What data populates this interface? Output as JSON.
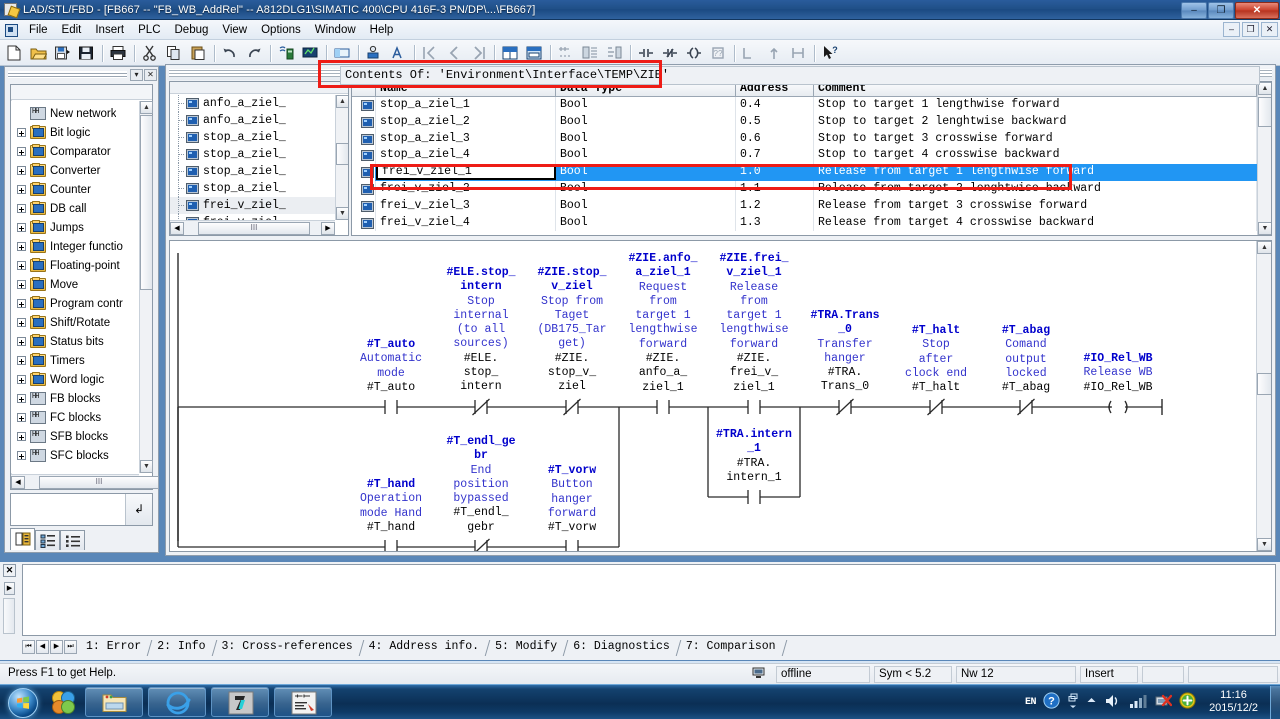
{
  "window": {
    "title": "LAD/STL/FBD  - [FB667 -- \"FB_WB_AddRel\" -- A812DLG1\\SIMATIC 400\\CPU 416F-3 PN/DP\\...\\FB667]",
    "minimize_label": "–",
    "restore_label": "❐",
    "close_label": "✕",
    "mdi_minimize_label": "–",
    "mdi_restore_label": "❐",
    "mdi_close_label": "✕"
  },
  "menu": {
    "items": [
      {
        "label": "File"
      },
      {
        "label": "Edit"
      },
      {
        "label": "Insert"
      },
      {
        "label": "PLC"
      },
      {
        "label": "Debug"
      },
      {
        "label": "View"
      },
      {
        "label": "Options"
      },
      {
        "label": "Window"
      },
      {
        "label": "Help"
      }
    ]
  },
  "toolbar": {
    "buttons": [
      {
        "name": "new-icon"
      },
      {
        "name": "open-icon"
      },
      {
        "name": "save-as-icon"
      },
      {
        "name": "save-icon"
      },
      {
        "sep": true
      },
      {
        "name": "print-icon"
      },
      {
        "sep": true
      },
      {
        "name": "cut-icon"
      },
      {
        "name": "copy-icon"
      },
      {
        "name": "paste-icon"
      },
      {
        "sep": true
      },
      {
        "name": "undo-icon"
      },
      {
        "name": "redo-icon"
      },
      {
        "sep": true
      },
      {
        "name": "download-icon"
      },
      {
        "name": "monitor-icon"
      },
      {
        "sep": true
      },
      {
        "name": "overview-icon"
      },
      {
        "sep": true
      },
      {
        "name": "symbol-icon"
      },
      {
        "name": "symbol-info-icon"
      },
      {
        "sep": true
      },
      {
        "name": "goto-first-icon"
      },
      {
        "name": "goto-prev-icon"
      },
      {
        "name": "goto-next-icon"
      },
      {
        "sep": true
      },
      {
        "name": "declaration-view-icon"
      },
      {
        "name": "code-view-icon"
      },
      {
        "sep": true
      },
      {
        "name": "new-network-icon"
      },
      {
        "name": "program-elements-icon"
      },
      {
        "name": "call-structure-icon"
      },
      {
        "sep": true
      },
      {
        "name": "contact-no-icon"
      },
      {
        "name": "contact-nc-icon"
      },
      {
        "name": "coil-icon"
      },
      {
        "name": "empty-box-icon"
      },
      {
        "sep": true
      },
      {
        "name": "branch-open-icon"
      },
      {
        "name": "branch-up-icon"
      },
      {
        "name": "branch-close-icon"
      },
      {
        "sep": true
      },
      {
        "name": "help-context-icon"
      }
    ]
  },
  "program_elements": {
    "panel_title": "",
    "dropdown_label": "▾",
    "close_label": "✕",
    "items": [
      {
        "label": "New network",
        "icon": "new-network-icon",
        "expandable": false
      },
      {
        "label": "Bit logic",
        "icon": "folder-icon",
        "expandable": true
      },
      {
        "label": "Comparator",
        "icon": "folder-icon",
        "expandable": true
      },
      {
        "label": "Converter",
        "icon": "folder-icon",
        "expandable": true
      },
      {
        "label": "Counter",
        "icon": "folder-icon",
        "expandable": true
      },
      {
        "label": "DB call",
        "icon": "folder-icon",
        "expandable": true
      },
      {
        "label": "Jumps",
        "icon": "folder-icon",
        "expandable": true
      },
      {
        "label": "Integer functio",
        "icon": "folder-icon",
        "expandable": true
      },
      {
        "label": "Floating-point",
        "icon": "folder-icon",
        "expandable": true
      },
      {
        "label": "Move",
        "icon": "folder-icon",
        "expandable": true
      },
      {
        "label": "Program contr",
        "icon": "folder-icon",
        "expandable": true
      },
      {
        "label": "Shift/Rotate",
        "icon": "folder-icon",
        "expandable": true
      },
      {
        "label": "Status bits",
        "icon": "folder-icon",
        "expandable": true
      },
      {
        "label": "Timers",
        "icon": "folder-icon",
        "expandable": true
      },
      {
        "label": "Word logic",
        "icon": "folder-icon",
        "expandable": true
      },
      {
        "label": "FB blocks",
        "icon": "fb-icon",
        "expandable": true
      },
      {
        "label": "FC blocks",
        "icon": "fc-icon",
        "expandable": true
      },
      {
        "label": "SFB blocks",
        "icon": "sfb-icon",
        "expandable": true
      },
      {
        "label": "SFC blocks",
        "icon": "sfc-icon",
        "expandable": true
      }
    ],
    "scroll_up": "▲",
    "scroll_down": "▼",
    "h_left": "◀",
    "h_right": "▶",
    "h_thumb_label": "III",
    "jump_button": "↲",
    "tabs": [
      {
        "name": "tab-program-elements",
        "active": true
      },
      {
        "name": "tab-call-structure",
        "active": false
      },
      {
        "name": "tab-details",
        "active": false
      }
    ]
  },
  "declaration": {
    "contents_of": "Contents Of: 'Environment\\Interface\\TEMP\\ZIE'",
    "nav_items": [
      {
        "label": "anfo_a_ziel_",
        "selected": false
      },
      {
        "label": "anfo_a_ziel_",
        "selected": false
      },
      {
        "label": "stop_a_ziel_",
        "selected": false
      },
      {
        "label": "stop_a_ziel_",
        "selected": false
      },
      {
        "label": "stop_a_ziel_",
        "selected": false
      },
      {
        "label": "stop_a_ziel_",
        "selected": false
      },
      {
        "label": "frei_v_ziel_",
        "selected": true
      },
      {
        "label": "frei_v_ziel_",
        "selected": false
      }
    ],
    "columns": [
      "Name",
      "Data Type",
      "Address",
      "Comment"
    ],
    "rows": [
      {
        "name": "stop_a_ziel_1",
        "type": "Bool",
        "address": "0.4",
        "comment": "Stop to target 1 lengthwise forward",
        "selected": false,
        "editing": false
      },
      {
        "name": "stop_a_ziel_2",
        "type": "Bool",
        "address": "0.5",
        "comment": "Stop to target 2 lenghtwise backward",
        "selected": false,
        "editing": false
      },
      {
        "name": "stop_a_ziel_3",
        "type": "Bool",
        "address": "0.6",
        "comment": "Stop to target 3 crosswise forward",
        "selected": false,
        "editing": false
      },
      {
        "name": "stop_a_ziel_4",
        "type": "Bool",
        "address": "0.7",
        "comment": "Stop to target 4 crosswise backward",
        "selected": false,
        "editing": false
      },
      {
        "name": "frei_v_ziel_1",
        "type": "Bool",
        "address": "1.0",
        "comment": "Release from target 1 lengthwise forward",
        "selected": true,
        "editing": true
      },
      {
        "name": "frei_v_ziel_2",
        "type": "Bool",
        "address": "1.1",
        "comment": "Release from target 2 lenghtwise backward",
        "selected": false,
        "editing": false
      },
      {
        "name": "frei_v_ziel_3",
        "type": "Bool",
        "address": "1.2",
        "comment": "Release from target 3 crosswise forward",
        "selected": false,
        "editing": false
      },
      {
        "name": "frei_v_ziel_4",
        "type": "Bool",
        "address": "1.3",
        "comment": "Release from target 4 crosswise backward",
        "selected": false,
        "editing": false
      }
    ]
  },
  "ladder": {
    "rung1": [
      {
        "symbol": "#T_auto",
        "comment": "Automatic\nmode",
        "address": "#T_auto",
        "type": "contact-no"
      },
      {
        "symbol": "#ELE.stop_\nintern",
        "comment": "Stop\ninternal\n(to all\nsources)",
        "address": "#ELE.\nstop_\nintern",
        "type": "contact-nc"
      },
      {
        "symbol": "#ZIE.stop_\nv_ziel",
        "comment": "Stop from\nTaget\n(DB175_Tar\nget)",
        "address": "#ZIE.\nstop_v_\nziel",
        "type": "contact-nc"
      },
      {
        "symbol": "#ZIE.anfo_\na_ziel_1",
        "comment": "Request\nfrom\ntarget 1\nlengthwise\nforward",
        "address": "#ZIE.\nanfo_a_\nziel_1",
        "type": "contact-no"
      },
      {
        "symbol": "#ZIE.frei_\nv_ziel_1",
        "comment": "Release\nfrom\ntarget 1\nlengthwise\nforward",
        "address": "#ZIE.\nfrei_v_\nziel_1",
        "type": "contact-no"
      },
      {
        "symbol": "#TRA.Trans\n_0",
        "comment": "Transfer\nhanger",
        "address": "#TRA.\nTrans_0",
        "type": "contact-nc"
      },
      {
        "symbol": "#T_halt",
        "comment": "Stop\nafter\nclock end",
        "address": "#T_halt",
        "type": "contact-nc"
      },
      {
        "symbol": "#T_abag",
        "comment": "Comand\noutput\nlocked",
        "address": "#T_abag",
        "type": "contact-nc"
      },
      {
        "symbol": "#IO_Rel_WB",
        "comment": "Release WB",
        "address": "#IO_Rel_WB",
        "type": "coil"
      }
    ],
    "rung2": [
      {
        "symbol": "#T_hand",
        "comment": "Operation\nmode Hand",
        "address": "#T_hand",
        "type": "contact-no"
      },
      {
        "symbol": "#T_endl_ge\nbr",
        "comment": "End\nposition\nbypassed",
        "address": "#T_endl_\ngebr",
        "type": "contact-nc"
      },
      {
        "symbol": "#T_vorw",
        "comment": "Button\nhanger\nforward",
        "address": "#T_vorw",
        "type": "contact-no"
      },
      {
        "symbol": "#TRA.intern\n_1",
        "comment": "",
        "address": "#TRA.\nintern_1",
        "type": "contact-no"
      }
    ],
    "scroll_up": "▲",
    "scroll_down": "▼"
  },
  "output": {
    "close_label": "✕",
    "expand_label": "▶",
    "nav": [
      "⏮",
      "◀",
      "▶",
      "⏭"
    ],
    "tabs": [
      {
        "label": "1: Error",
        "active": false
      },
      {
        "label": "2: Info",
        "active": true
      },
      {
        "label": "3: Cross-references",
        "active": false
      },
      {
        "label": "4: Address info.",
        "active": false
      },
      {
        "label": "5: Modify",
        "active": false
      },
      {
        "label": "6: Diagnostics",
        "active": false
      },
      {
        "label": "7: Comparison",
        "active": false
      }
    ]
  },
  "statusbar": {
    "message": "Press F1 to get Help.",
    "connection": "offline",
    "symbols": "Sym < 5.2",
    "network": "Nw 12",
    "mode": "Insert"
  },
  "taskbar": {
    "start_label": "Start",
    "quick_items": [
      {
        "name": "explorer-icon"
      },
      {
        "name": "internet-explorer-icon"
      },
      {
        "name": "step7-icon"
      },
      {
        "name": "lad-stl-fbd-icon"
      }
    ],
    "tray": {
      "language": "EN",
      "help_icon": "help-icon",
      "show_hidden_icon": "chevron-up-icon",
      "volume_icon": "speaker-icon",
      "network_icon": "signal-bars-icon",
      "network_error_icon": "network-error-icon",
      "update_icon": "update-icon",
      "time": "11:16",
      "date": "2015/12/2"
    }
  },
  "colors": {
    "selection_blue": "#2196f3",
    "symbol_blue": "#0000cc",
    "comment_blue": "#3333cc",
    "annotation_red": "#ee1c16",
    "titlebar_blue": "#1b4a82"
  }
}
